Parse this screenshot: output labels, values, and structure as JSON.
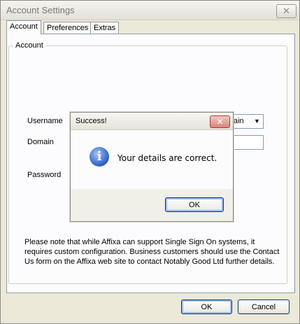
{
  "window": {
    "title": "Account Settings",
    "close_symbol": "✕"
  },
  "tabs": [
    {
      "label": "Account",
      "active": true
    },
    {
      "label": "Preferences",
      "active": false
    },
    {
      "label": "Extras",
      "active": false
    }
  ],
  "account_group": {
    "label": "Account",
    "username_label": "Username",
    "domain_label": "Domain",
    "password_label": "Password",
    "domain_dropdown_visible": "ain",
    "note": "Please note that while Affixa can support Single Sign On systems, it requires custom configuration. Business customers should use the Contact Us form on the Affixa web site to contact Notably Good Ltd further details."
  },
  "buttons": {
    "ok": "OK",
    "cancel": "Cancel"
  },
  "dialog": {
    "title": "Success!",
    "close_symbol": "✕",
    "icon": "info-icon",
    "message": "Your details are correct.",
    "ok": "OK"
  },
  "colors": {
    "accent": "#003c74",
    "info_icon": "#2a5fc2"
  }
}
